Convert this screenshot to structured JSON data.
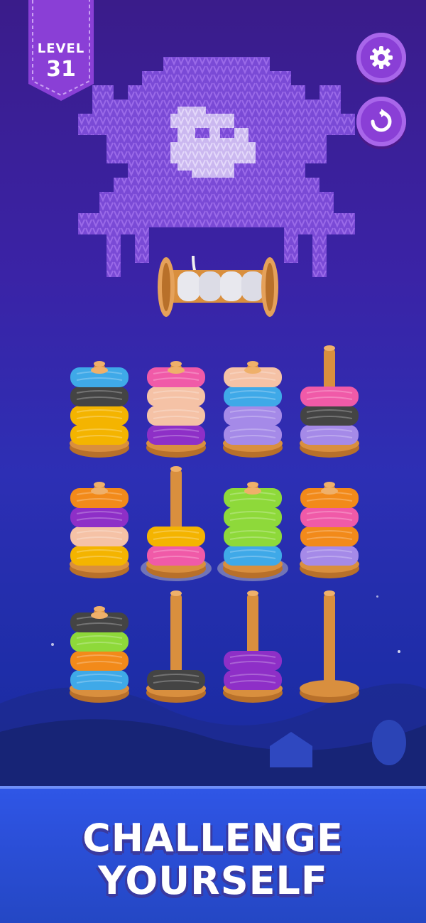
{
  "hud": {
    "level_label": "LEVEL",
    "level_number": "31",
    "settings_icon": "gear-icon",
    "restart_icon": "restart-icon"
  },
  "board": {
    "rows": [
      [
        {
          "rings": [
            "#f4b400",
            "#f4b400",
            "#444444",
            "#3fa9e8"
          ],
          "empty": false
        },
        {
          "rings": [
            "#8e2fc7",
            "#f5c2a6",
            "#f5c2a6",
            "#f05aa8"
          ],
          "empty": false
        },
        {
          "rings": [
            "#a58ae8",
            "#a58ae8",
            "#3fa9e8",
            "#f5c2a6"
          ],
          "empty": false
        },
        {
          "rings": [
            "#a58ae8",
            "#444444",
            "#f05aa8"
          ],
          "empty": false
        }
      ],
      [
        {
          "rings": [
            "#f4b400",
            "#f5c2a6",
            "#8e2fc7",
            "#f28a1a"
          ],
          "empty": false
        },
        {
          "rings": [
            "#f05aa8",
            "#f4b400"
          ],
          "empty": false,
          "selected": true
        },
        {
          "rings": [
            "#3fa9e8",
            "#8ed93a",
            "#8ed93a",
            "#8ed93a"
          ],
          "empty": false,
          "selected": true
        },
        {
          "rings": [
            "#a58ae8",
            "#f28a1a",
            "#f05aa8",
            "#f28a1a"
          ],
          "empty": false
        }
      ],
      [
        {
          "rings": [
            "#3fa9e8",
            "#f28a1a",
            "#8ed93a",
            "#444444"
          ],
          "empty": false
        },
        {
          "rings": [
            "#444444"
          ],
          "empty": false
        },
        {
          "rings": [
            "#8e2fc7",
            "#8e2fc7"
          ],
          "empty": false
        },
        {
          "rings": [],
          "empty": true
        }
      ]
    ]
  },
  "banner": {
    "line1": "CHALLENGE",
    "line2": "YOURSELF"
  },
  "colors": {
    "wood": "#d98f3e",
    "wood_dark": "#b8702a",
    "knit": "#7a4ad6",
    "knit_light": "#cbb8f0"
  }
}
